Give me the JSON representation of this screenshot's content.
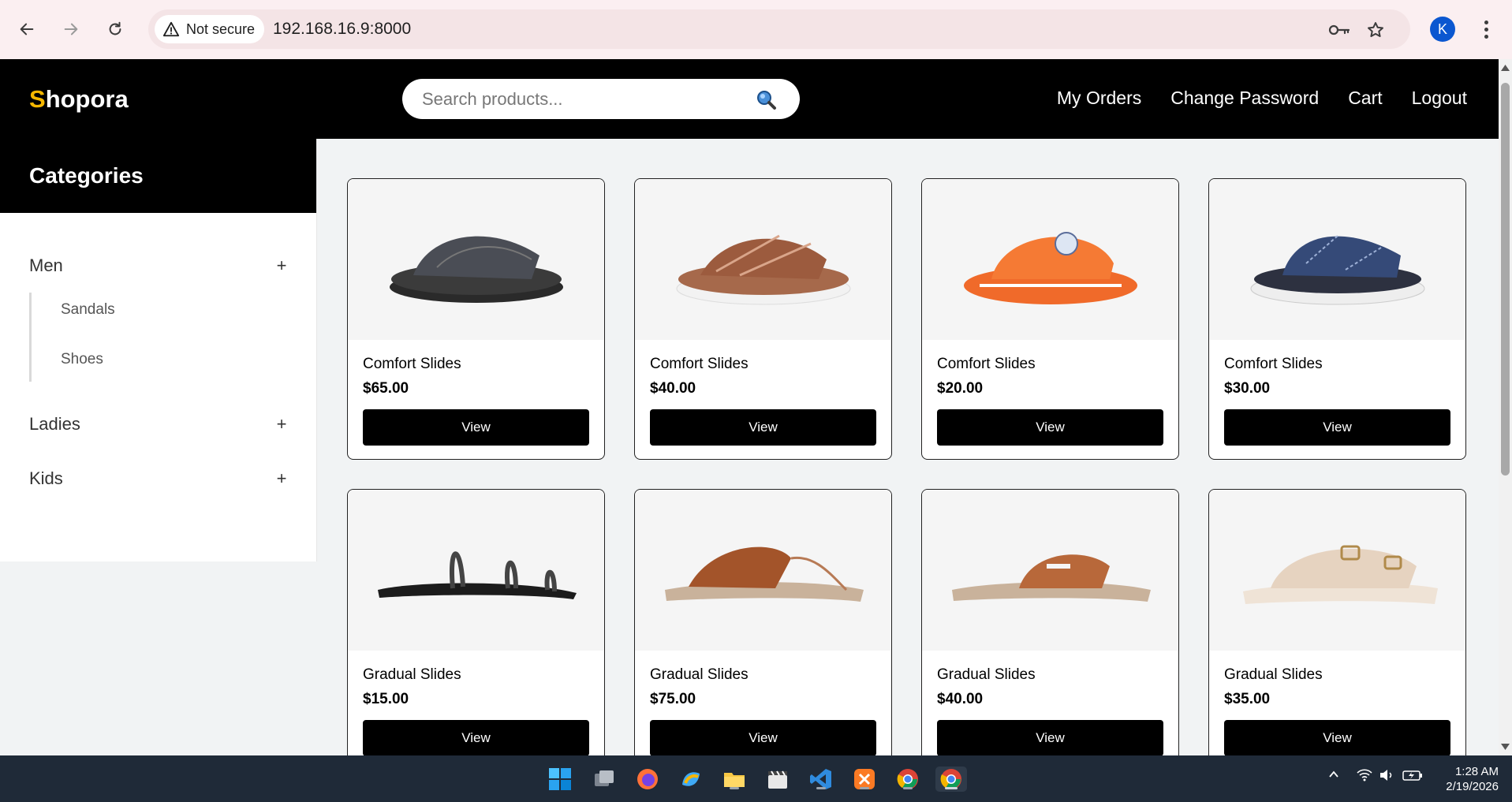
{
  "browser": {
    "security_label": "Not secure",
    "url": "192.168.16.9:8000",
    "profile_initial": "K"
  },
  "site": {
    "logo_first": "S",
    "logo_rest": "hopora",
    "search_placeholder": "Search products...",
    "nav": [
      "My Orders",
      "Change Password",
      "Cart",
      "Logout"
    ]
  },
  "sidebar": {
    "title": "Categories",
    "categories": [
      {
        "label": "Men",
        "toggle": "+",
        "subcategories": [
          "Sandals",
          "Shoes"
        ]
      },
      {
        "label": "Ladies",
        "toggle": "+"
      },
      {
        "label": "Kids",
        "toggle": "+"
      }
    ]
  },
  "products": [
    {
      "name": "Comfort Slides",
      "price": "$65.00",
      "button": "View"
    },
    {
      "name": "Comfort Slides",
      "price": "$40.00",
      "button": "View"
    },
    {
      "name": "Comfort Slides",
      "price": "$20.00",
      "button": "View"
    },
    {
      "name": "Comfort Slides",
      "price": "$30.00",
      "button": "View"
    },
    {
      "name": "Gradual Slides",
      "price": "$15.00",
      "button": "View"
    },
    {
      "name": "Gradual Slides",
      "price": "$75.00",
      "button": "View"
    },
    {
      "name": "Gradual Slides",
      "price": "$40.00",
      "button": "View"
    },
    {
      "name": "Gradual Slides",
      "price": "$35.00",
      "button": "View"
    }
  ],
  "taskbar": {
    "time": "1:28 AM",
    "date": "2/19/2026"
  },
  "colors": {
    "logo_accent": "#f5b700",
    "header_bg": "#000000",
    "page_bg": "#f1f3f4",
    "button_bg": "#000000"
  }
}
